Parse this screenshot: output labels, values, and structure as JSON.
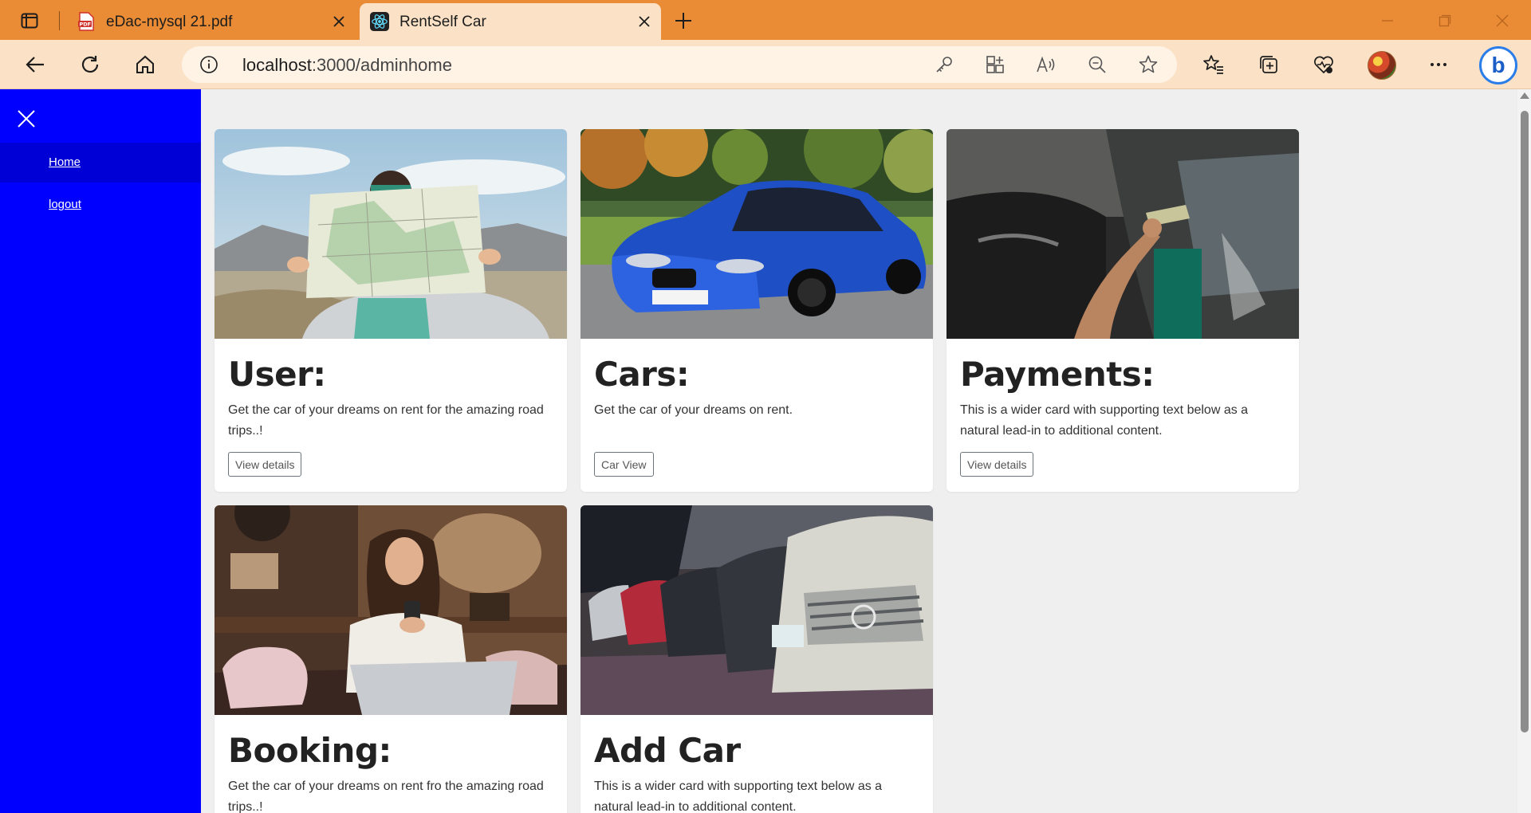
{
  "browser": {
    "tabs": [
      {
        "title": "eDac-mysql 21.pdf",
        "icon": "pdf-file-icon",
        "active": false
      },
      {
        "title": "RentSelf Car",
        "icon": "react-logo-icon",
        "active": true
      }
    ],
    "url_host": "localhost",
    "url_path": ":3000/adminhome"
  },
  "sidebar": {
    "items": [
      {
        "label": "Home",
        "active": true
      },
      {
        "label": "logout",
        "active": false
      }
    ]
  },
  "cards": [
    {
      "title": "User:",
      "text": "Get the car of your dreams on rent for the amazing road trips..!",
      "button": "View details",
      "image": "woman-reading-map-photo"
    },
    {
      "title": "Cars:",
      "text": "Get the car of your dreams on rent.",
      "button": "Car View",
      "image": "blue-bmw-car-photo"
    },
    {
      "title": "Payments:",
      "text": "This is a wider card with supporting text below as a natural lead-in to additional content.",
      "button": "View details",
      "image": "cash-payment-photo"
    },
    {
      "title": "Booking:",
      "text": "Get the car of your dreams on rent fro the amazing road trips..!",
      "button": "",
      "image": "woman-with-phone-laptop-photo"
    },
    {
      "title": "Add Car",
      "text": "This is a wider card with supporting text below as a natural lead-in to additional content.",
      "button": "",
      "image": "row-of-cars-photo"
    }
  ],
  "colors": {
    "tabbar": "#e98c35",
    "toolbar": "#fbe2c6",
    "sidebar": "#0000ff",
    "sidebar_active": "#0000d6",
    "page_bg": "#efefef"
  }
}
